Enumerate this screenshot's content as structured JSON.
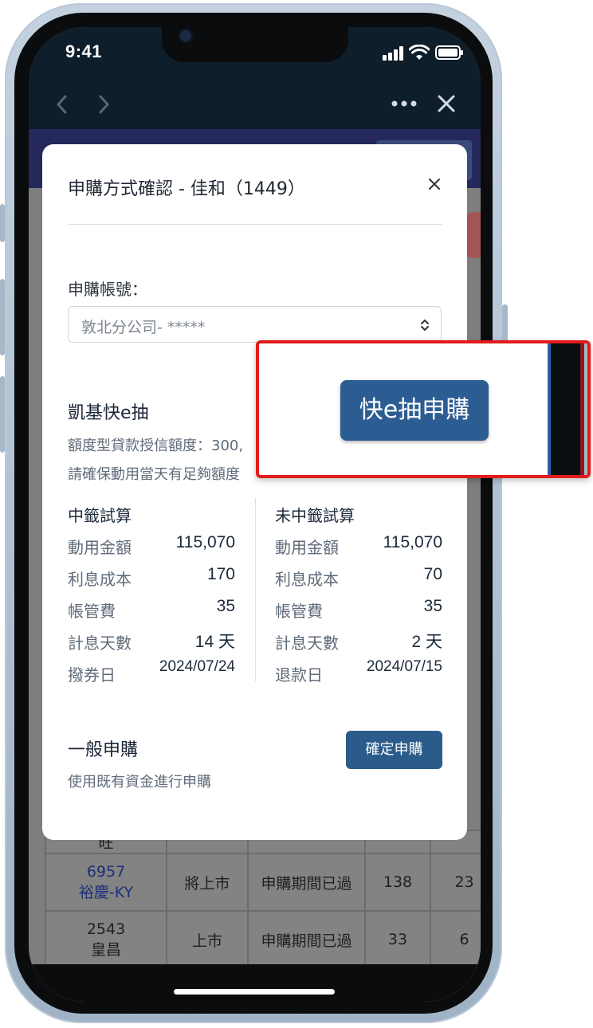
{
  "status_bar": {
    "time": "9:41"
  },
  "nav": {
    "back_icon": "chevron-left-icon",
    "forward_icon": "chevron-right-icon",
    "more_icon": "more-dots-icon",
    "close_icon": "close-icon"
  },
  "modal": {
    "title": "申購方式確認 - 佳和（1449）",
    "close_icon": "close-icon",
    "account_label": "申購帳號：",
    "account_value": "敦北分公司- *****",
    "kgi": {
      "title": "凱基快e抽",
      "line1": "額度型貸款授信額度：300,",
      "line2": "請確保動用當天有足夠額度"
    },
    "win_calc": {
      "title": "中籤試算",
      "rows": [
        {
          "label": "動用金額",
          "value": "115,070"
        },
        {
          "label": "利息成本",
          "value": "170"
        },
        {
          "label": "帳管費",
          "value": "35"
        },
        {
          "label": "計息天數",
          "value": "14 天"
        },
        {
          "label": "撥券日",
          "value": "2024/07/24"
        }
      ]
    },
    "lose_calc": {
      "title": "未中籤試算",
      "rows": [
        {
          "label": "動用金額",
          "value": "115,070"
        },
        {
          "label": "利息成本",
          "value": "70"
        },
        {
          "label": "帳管費",
          "value": "35"
        },
        {
          "label": "計息天數",
          "value": "2 天"
        },
        {
          "label": "退款日",
          "value": "2024/07/15"
        }
      ]
    },
    "general": {
      "title": "一般申購",
      "desc": "使用既有資金進行申購",
      "button": "確定申購"
    }
  },
  "callout": {
    "button": "快e抽申購"
  },
  "background_table": {
    "partial_row_text": "旺",
    "rows": [
      {
        "code": "6957",
        "name": "裕慶-KY",
        "market": "將上市",
        "status": "申購期間已過",
        "col5": "138",
        "col6": "23"
      },
      {
        "code": "2543",
        "name": "皇昌",
        "market": "上市",
        "status": "申購期間已過",
        "col5": "33",
        "col6": "6"
      }
    ]
  },
  "colors": {
    "primary_button": "#2a5b8a",
    "callout_border": "#e21b1b",
    "header": "#0f1e2b"
  }
}
